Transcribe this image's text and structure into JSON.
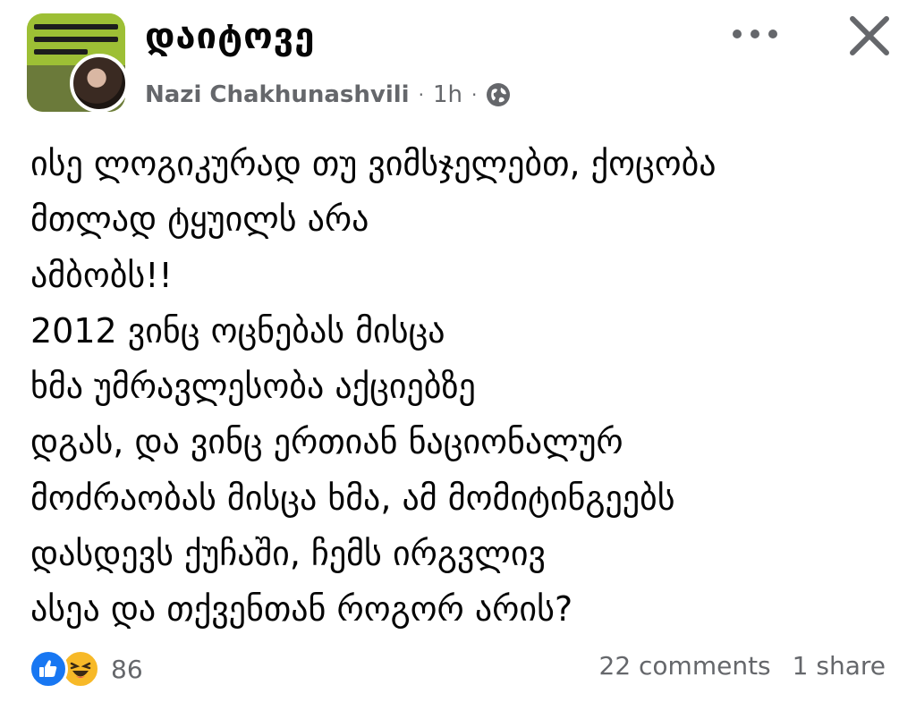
{
  "post": {
    "group_name": "დაიტოვე",
    "author": "Nazi Chakhunashvili",
    "time": "1h",
    "separator": "·",
    "audience_icon": "globe-icon",
    "body_lines": [
      "ისე ლოგიკურად თუ ვიმსჯელებთ, ქოცობა",
      "მთლად ტყუილს არა",
      "ამბობს!!",
      "2012 ვინც ოცნებას მისცა",
      "ხმა უმრავლესობა აქციებზე",
      "დგას, და ვინც ერთიან ნაციონალურ",
      "მოძრაობას მისცა ხმა, ამ მომიტინგეებს",
      "დასდევს ქუჩაში, ჩემს ირგვლივ",
      "ასეა და თქვენთან როგორ არის?"
    ]
  },
  "header_actions": {
    "more_icon": "more-horizontal-icon",
    "close_icon": "close-icon"
  },
  "footer": {
    "reaction_icons": [
      "like-icon",
      "haha-icon"
    ],
    "reaction_count": "86",
    "comments": "22 comments",
    "shares": "1 share"
  },
  "colors": {
    "primary_text": "#050505",
    "secondary_text": "#65676b",
    "like_blue": "#1877f2",
    "haha_yellow": "#f7b928",
    "group_avatar_green": "#a9c93a"
  }
}
